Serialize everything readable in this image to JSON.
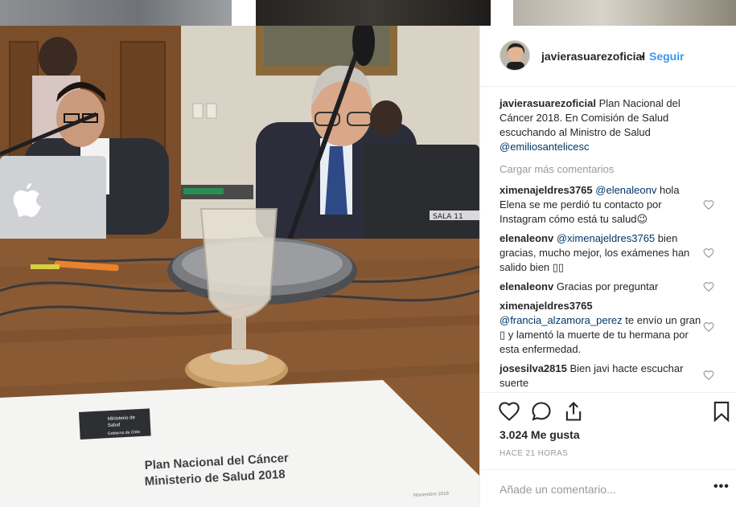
{
  "header": {
    "username": "javierasuarezoficial",
    "separator": "•",
    "follow_label": "Seguir"
  },
  "caption": {
    "username": "javierasuarezoficial",
    "text": "Plan Nacional del Cáncer 2018. En Comisión de Salud escuchando al Ministro de Salud",
    "mention": "@emiliosantelicesc"
  },
  "load_more_label": "Cargar más comentarios",
  "comments": [
    {
      "username": "ximenajeldres3765",
      "mention": "@elenaleonv",
      "text": " hola Elena se me perdió tu contacto por Instagram cómo está tu salud😉"
    },
    {
      "username": "elenaleonv",
      "mention": "@ximenajeldres3765",
      "text": " bien gracias, mucho mejor, los exámenes han salido bien ▯▯"
    },
    {
      "username": "elenaleonv",
      "mention": "",
      "text": "Gracias por preguntar"
    },
    {
      "username": "ximenajeldres3765",
      "mention": "@francia_alzamora_perez",
      "text": " te envío un gran ▯ y lamentó la muerte de tu hermana por esta enfermedad."
    },
    {
      "username": "josesilva2815",
      "mention": "",
      "text": "Bien javi hacte escuchar suerte"
    }
  ],
  "likes": "3.024 Me gusta",
  "timestamp": "HACE 21 HORAS",
  "add_comment_placeholder": "Añade un comentario...",
  "more_label": "•••",
  "photo": {
    "document_title_line1": "Plan Nacional del Cáncer",
    "document_title_line2": "Ministerio de Salud 2018",
    "logo_line1": "Ministerio de",
    "logo_line2": "Salud",
    "logo_line3": "Gobierno de Chile",
    "date": "Noviembre 2018",
    "laptop_label": "SALA 11"
  },
  "colors": {
    "accent": "#3897f0",
    "mention": "#003569",
    "muted": "#999999",
    "text": "#262626"
  },
  "icons": [
    "heart-icon",
    "comment-icon",
    "share-icon",
    "bookmark-icon",
    "apple-logo-icon"
  ]
}
